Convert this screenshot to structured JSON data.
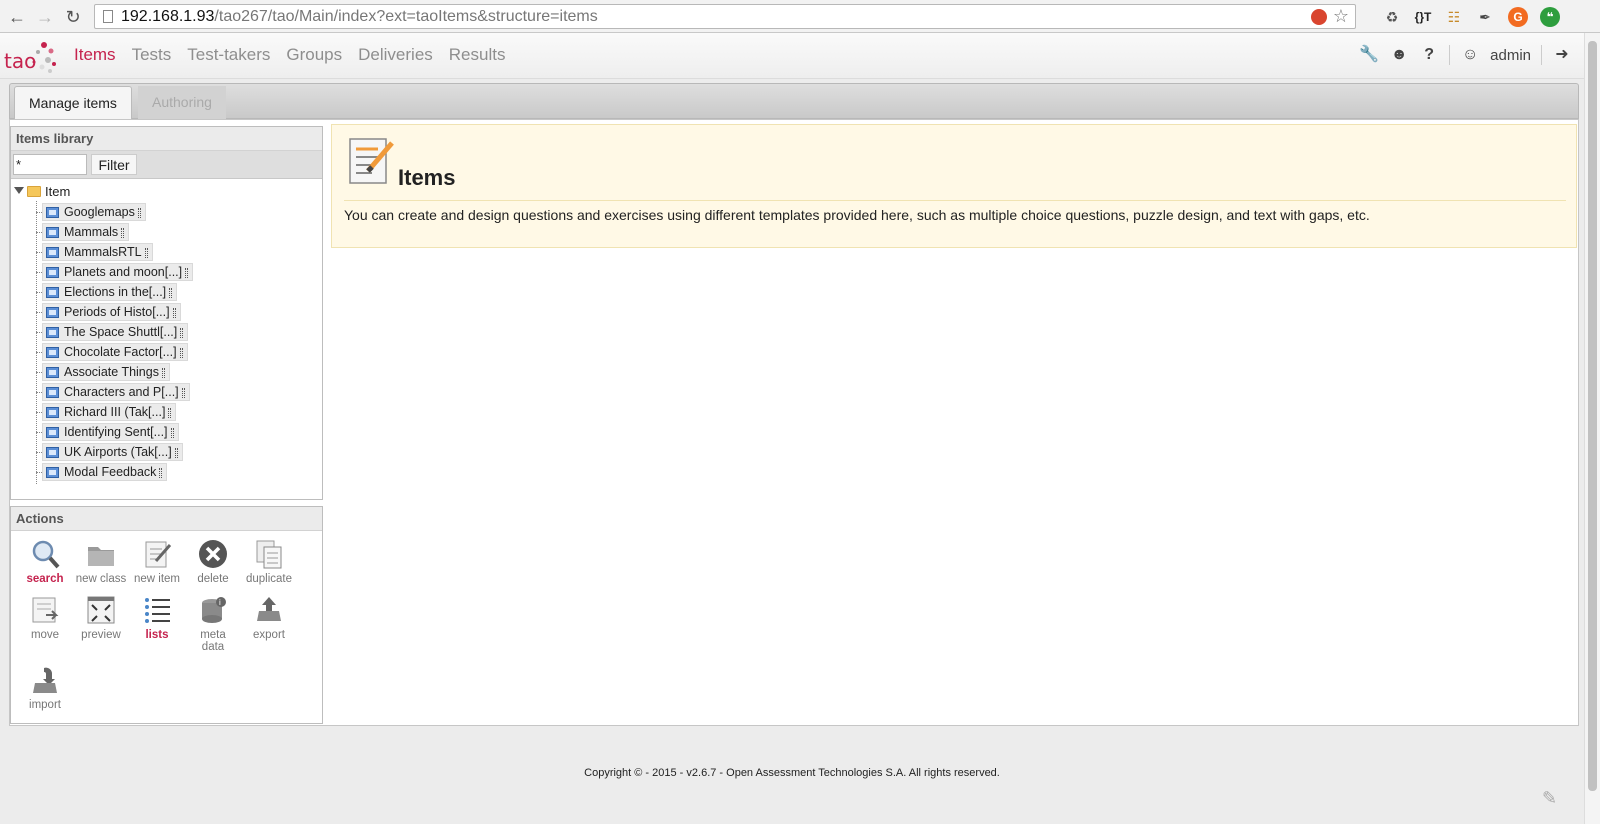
{
  "browser": {
    "url_host": "192.168.1.93",
    "url_path": "/tao267/tao/Main/index?ext=taoItems&structure=items",
    "back_icon": "arrow-left-icon",
    "forward_icon": "arrow-right-icon",
    "reload_icon": "reload-icon",
    "extensions": [
      "recycle-icon",
      "json-viewer-icon",
      "basket-icon",
      "signature-icon",
      "grammarly-icon",
      "hangouts-icon"
    ]
  },
  "app": {
    "logo_text": "tao",
    "nav": [
      "Items",
      "Tests",
      "Test-takers",
      "Groups",
      "Deliveries",
      "Results"
    ],
    "active_nav": "Items",
    "user_name": "admin",
    "accent_color": "#c5234e"
  },
  "tabs": {
    "manage": "Manage items",
    "authoring": "Authoring"
  },
  "library": {
    "title": "Items library",
    "filter_value": "*",
    "filter_button": "Filter",
    "root_label": "Item",
    "items": [
      "Googlemaps",
      "Mammals",
      "MammalsRTL",
      "Planets and moon[...]",
      "Elections in the[...]",
      "Periods of Histo[...]",
      "The Space Shuttl[...]",
      "Chocolate Factor[...]",
      "Associate Things",
      "Characters and P[...]",
      "Richard III (Tak[...]",
      "Identifying Sent[...]",
      "UK Airports (Tak[...]",
      "Modal Feedback"
    ]
  },
  "actions": {
    "title": "Actions",
    "search": "search",
    "new_class": "new class",
    "new_item": "new item",
    "delete": "delete",
    "duplicate": "duplicate",
    "move": "move",
    "preview": "preview",
    "lists": "lists",
    "meta_data_1": "meta",
    "meta_data_2": "data",
    "export": "export",
    "import": "import"
  },
  "main": {
    "title": "Items",
    "description": "You can create and design questions and exercises using different templates provided here, such as multiple choice questions, puzzle design, and text with gaps, etc."
  },
  "footer": {
    "copyright": "Copyright © - 2015 - v2.6.7 - Open Assessment Technologies S.A. All rights reserved."
  }
}
